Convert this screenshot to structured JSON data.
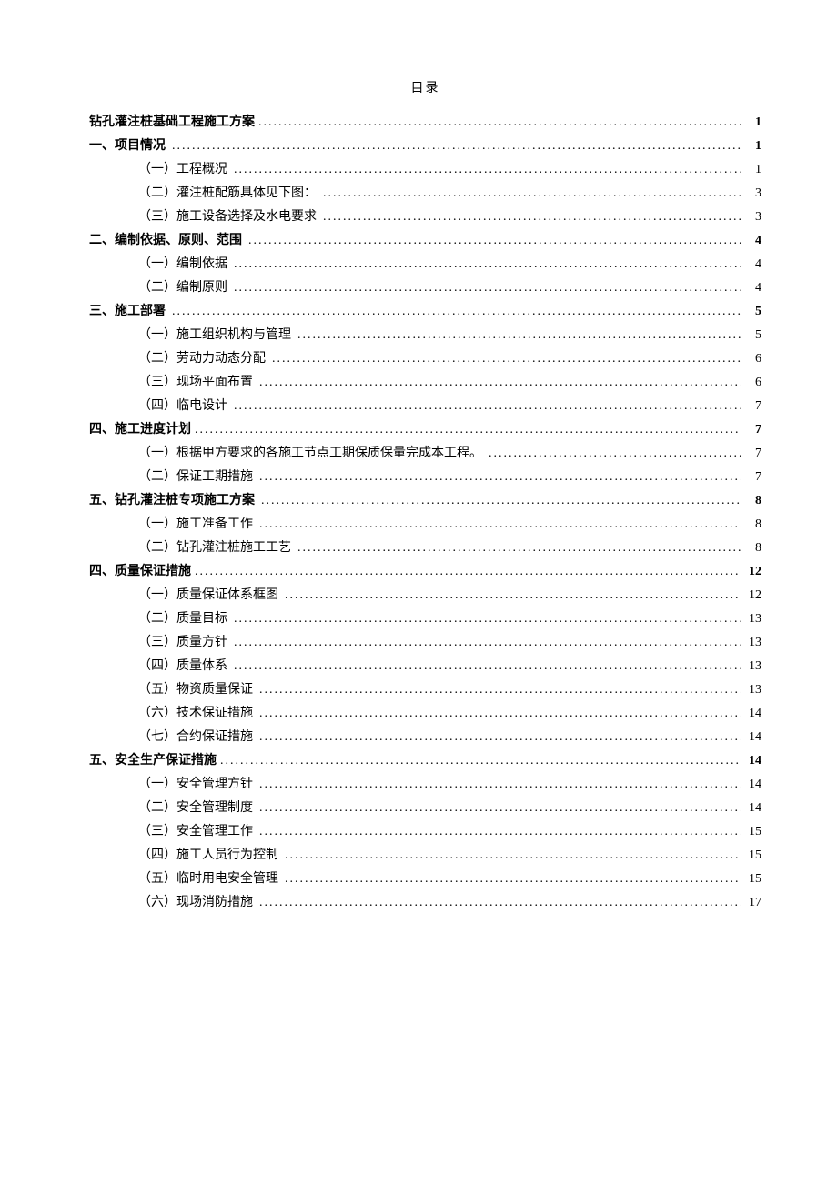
{
  "title": "目录",
  "entries": [
    {
      "level": 0,
      "text": "钻孔灌注桩基础工程施工方案",
      "page": "1"
    },
    {
      "level": 0,
      "text": "一、项目情况",
      "page": "1",
      "gap": true
    },
    {
      "level": 1,
      "text": "（一）工程概况",
      "page": "1",
      "gap": true
    },
    {
      "level": 1,
      "text": "（二）灌注桩配筋具体见下图：",
      "page": "3",
      "gap": true
    },
    {
      "level": 1,
      "text": "（三）施工设备选择及水电要求",
      "page": "3",
      "gap": true
    },
    {
      "level": 0,
      "text": "二、编制依据、原则、范围",
      "page": "4",
      "gap": true
    },
    {
      "level": 1,
      "text": "（一）编制依据",
      "page": "4",
      "gap": true
    },
    {
      "level": 1,
      "text": "（二）编制原则",
      "page": "4",
      "gap": true
    },
    {
      "level": 0,
      "text": "三、施工部署",
      "page": "5",
      "gap": true
    },
    {
      "level": 1,
      "text": "（一）施工组织机构与管理",
      "page": "5",
      "gap": true
    },
    {
      "level": 1,
      "text": "（二）劳动力动态分配",
      "page": "6",
      "gap": true
    },
    {
      "level": 1,
      "text": "（三）现场平面布置",
      "page": "6",
      "gap": true
    },
    {
      "level": 1,
      "text": "（四）临电设计",
      "page": "7",
      "gap": true
    },
    {
      "level": 0,
      "text": "四、施工进度计划",
      "page": "7"
    },
    {
      "level": 1,
      "text": "（一）根据甲方要求的各施工节点工期保质保量完成本工程。",
      "page": "7",
      "gap": true
    },
    {
      "level": 1,
      "text": "（二）保证工期措施",
      "page": "7",
      "gap": true
    },
    {
      "level": 0,
      "text": "五、钻孔灌注桩专项施工方案",
      "page": "8",
      "gap": true
    },
    {
      "level": 1,
      "text": "（一）施工准备工作",
      "page": "8",
      "gap": true
    },
    {
      "level": 1,
      "text": "（二）钻孔灌注桩施工工艺",
      "page": "8",
      "gap": true
    },
    {
      "level": 0,
      "text": "四、质量保证措施",
      "page": "12"
    },
    {
      "level": 1,
      "text": "（一）质量保证体系框图",
      "page": "12",
      "gap": true
    },
    {
      "level": 1,
      "text": "（二）质量目标",
      "page": "13",
      "gap": true
    },
    {
      "level": 1,
      "text": "（三）质量方针",
      "page": "13",
      "gap": true
    },
    {
      "level": 1,
      "text": "（四）质量体系",
      "page": "13",
      "gap": true
    },
    {
      "level": 1,
      "text": "（五）物资质量保证",
      "page": "13",
      "gap": true
    },
    {
      "level": 1,
      "text": "（六）技术保证措施",
      "page": "14",
      "gap": true
    },
    {
      "level": 1,
      "text": "（七）合约保证措施",
      "page": "14",
      "gap": true
    },
    {
      "level": 0,
      "text": "五、安全生产保证措施",
      "page": "14"
    },
    {
      "level": 1,
      "text": "（一）安全管理方针",
      "page": "14",
      "gap": true
    },
    {
      "level": 1,
      "text": "（二）安全管理制度",
      "page": "14",
      "gap": true
    },
    {
      "level": 1,
      "text": "（三）安全管理工作",
      "page": "15",
      "gap": true
    },
    {
      "level": 1,
      "text": "（四）施工人员行为控制",
      "page": "15",
      "gap": true
    },
    {
      "level": 1,
      "text": "（五）临时用电安全管理",
      "page": "15",
      "gap": true
    },
    {
      "level": 1,
      "text": "（六）现场消防措施",
      "page": "17",
      "gap": true
    }
  ]
}
